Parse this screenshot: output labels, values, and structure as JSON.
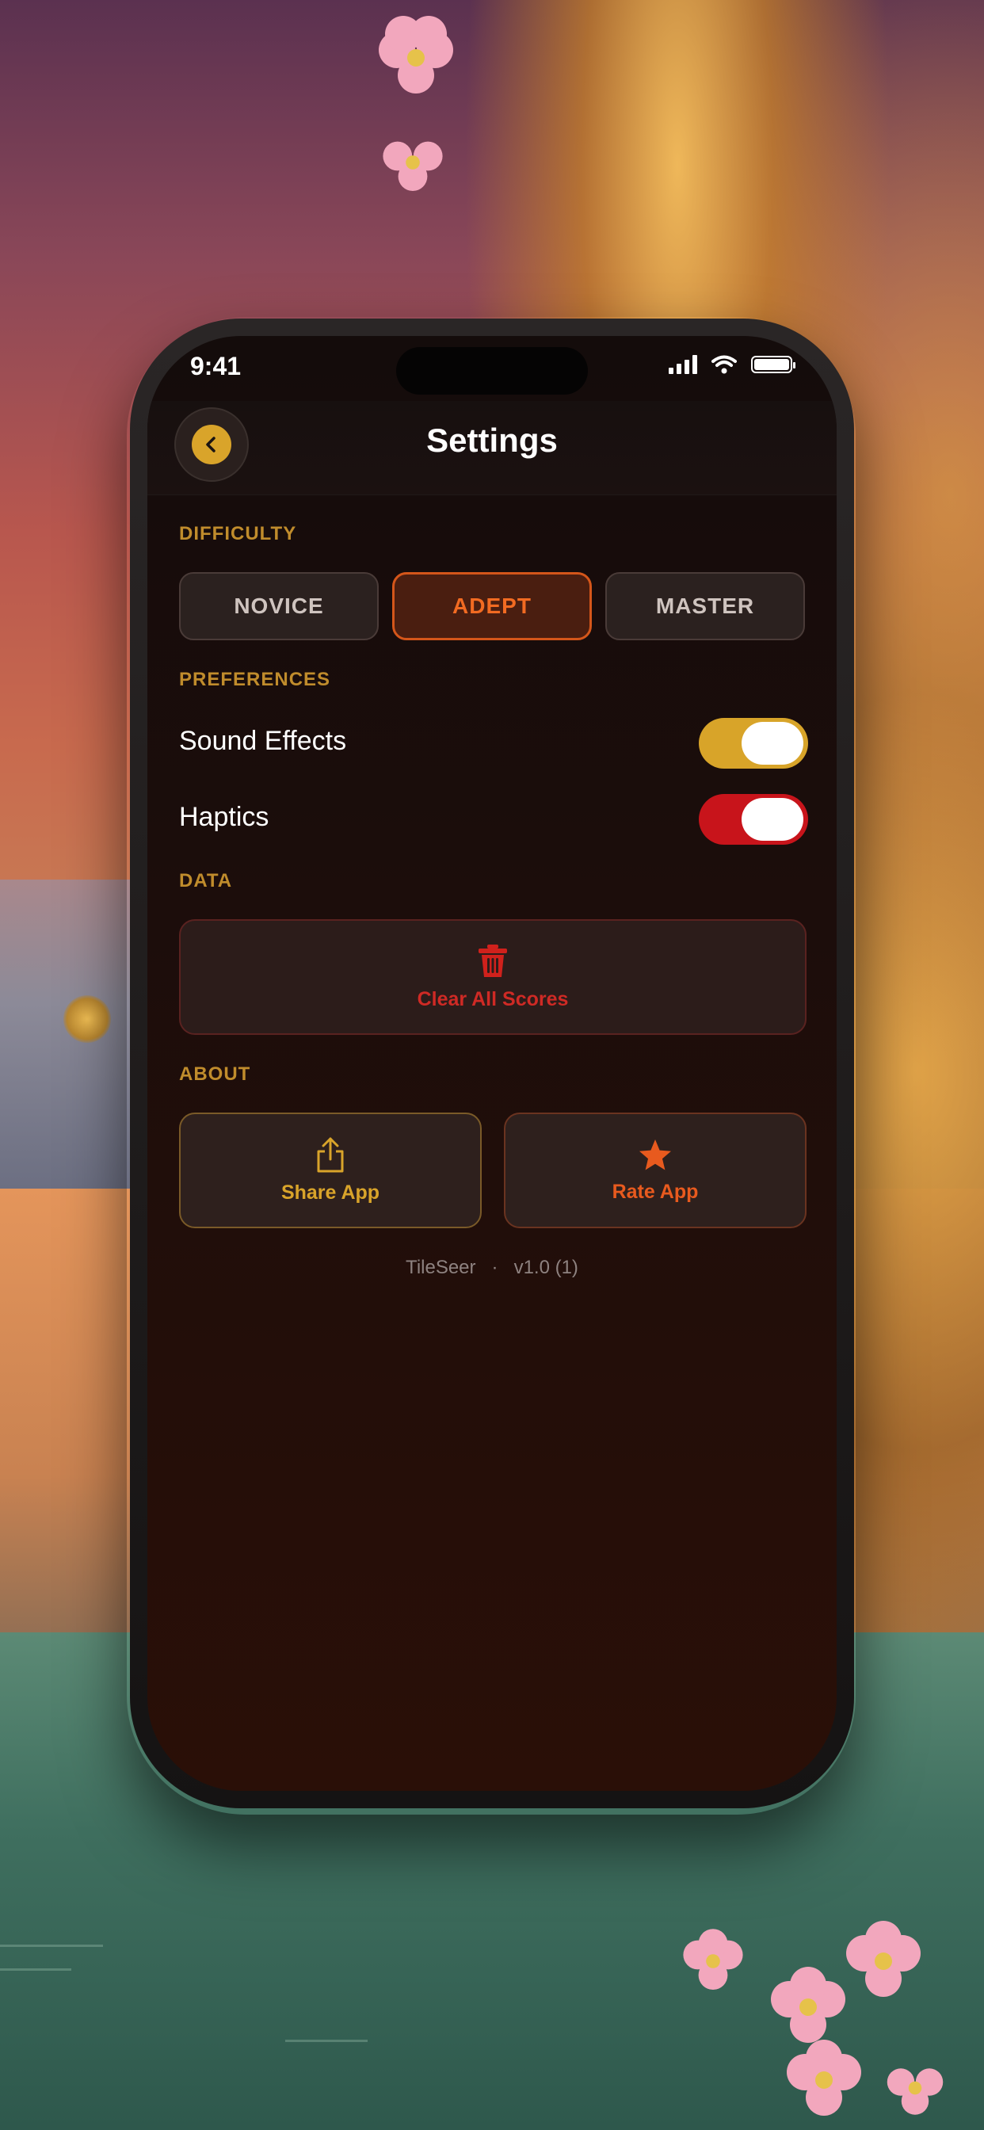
{
  "status_bar": {
    "time": "9:41"
  },
  "nav": {
    "title": "Settings"
  },
  "sections": {
    "difficulty": "DIFFICULTY",
    "preferences": "PREFERENCES",
    "data": "DATA",
    "about": "ABOUT"
  },
  "difficulty": {
    "options": [
      "NOVICE",
      "ADEPT",
      "MASTER"
    ],
    "selected": "ADEPT"
  },
  "preferences": {
    "sound_effects": {
      "label": "Sound Effects",
      "enabled": true
    },
    "haptics": {
      "label": "Haptics",
      "enabled": true
    }
  },
  "data": {
    "clear_label": "Clear All Scores"
  },
  "about": {
    "share_label": "Share App",
    "rate_label": "Rate App"
  },
  "footer": {
    "app_name": "TileSeer",
    "separator": "·",
    "version": "v1.0 (1)"
  },
  "colors": {
    "accent_gold": "#d9a42a",
    "accent_orange": "#f26b22",
    "danger_red": "#cf2a25",
    "haptics_toggle": "#c8141b"
  }
}
